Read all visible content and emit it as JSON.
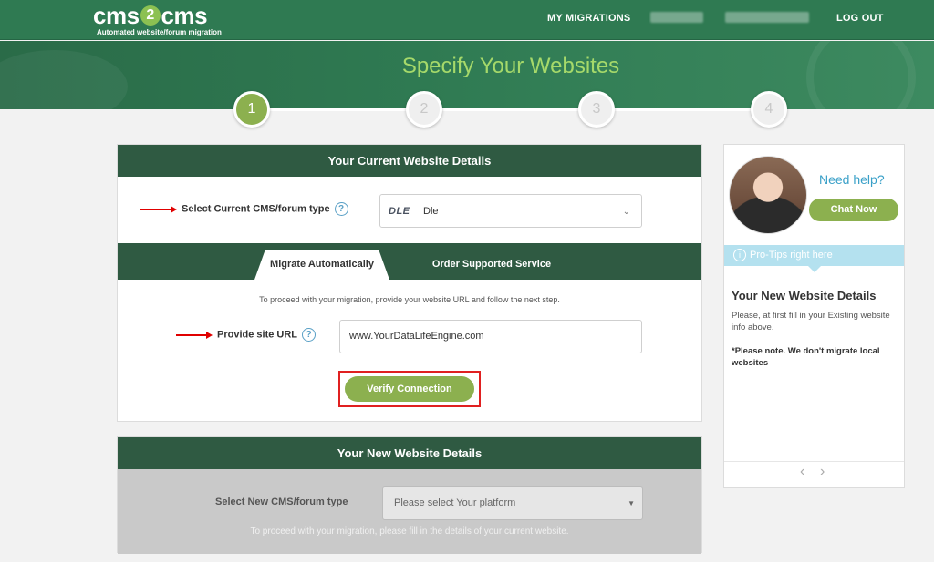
{
  "header": {
    "logo_left": "cms",
    "logo_mid": "2",
    "logo_right": "cms",
    "logo_tagline": "Automated website/forum migration",
    "nav_migrations": "MY MIGRATIONS",
    "nav_logout": "LOG OUT"
  },
  "banner": {
    "title": "Specify Your Websites"
  },
  "steps": [
    {
      "label": "1",
      "active": true
    },
    {
      "label": "2",
      "active": false
    },
    {
      "label": "3",
      "active": false
    },
    {
      "label": "4",
      "active": false
    }
  ],
  "current": {
    "heading": "Your Current Website Details",
    "cms_label": "Select Current CMS/forum type",
    "cms_help": "?",
    "cms_logo": "DLE",
    "cms_value": "Dle",
    "tab_auto": "Migrate Automatically",
    "tab_service": "Order Supported Service",
    "hint": "To proceed with your migration, provide your website URL and follow the next step.",
    "url_label": "Provide site URL",
    "url_help": "?",
    "url_value": "www.YourDataLifeEngine.com",
    "verify_label": "Verify Connection"
  },
  "new_site": {
    "heading": "Your New Website Details",
    "cms_label": "Select New CMS/forum type",
    "select_placeholder": "Please select Your platform",
    "hint": "To proceed with your migration, please fill in the details of your current website."
  },
  "sidebar": {
    "need_help": "Need help?",
    "chat_label": "Chat Now",
    "tips_label": "Pro-Tips right here",
    "tip_title": "Your New Website Details",
    "tip_text": "Please, at first fill in your Existing website info above.",
    "tip_note": "*Please note. We don't migrate local websites"
  },
  "colors": {
    "header_green": "#2f7a52",
    "panel_head": "#2f5a42",
    "accent_green": "#8cb04f",
    "banner_title": "#a6d96a",
    "help_blue": "#3aa0c8",
    "tips_bar": "#b4e1ef",
    "annotation_red": "#e00000"
  }
}
